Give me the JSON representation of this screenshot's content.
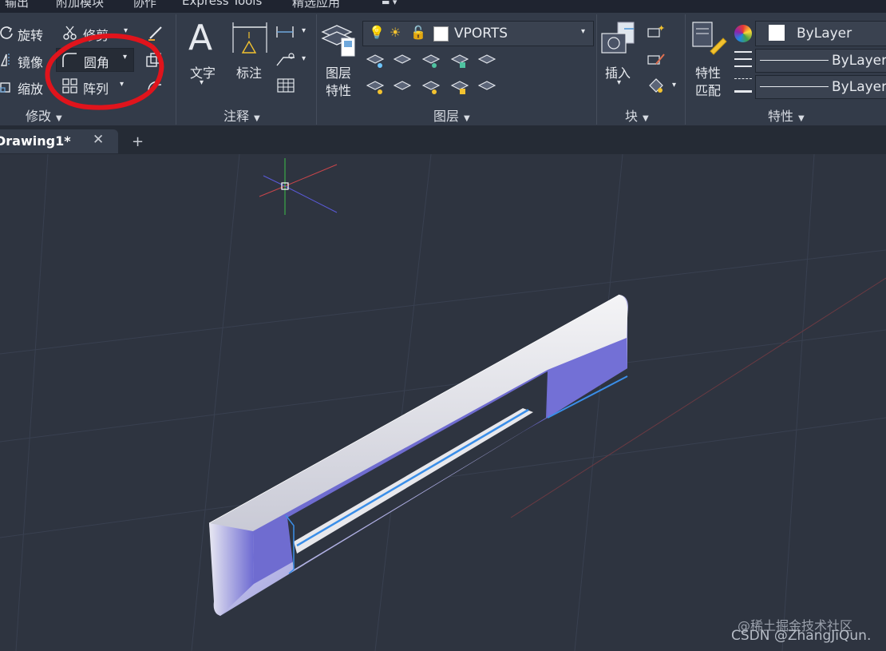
{
  "top_menu": [
    "输出",
    "附加模块",
    "协作",
    "Express Tools",
    "精选应用"
  ],
  "modify_panel": {
    "rotate": "旋转",
    "trim": "修剪",
    "mirror": "镜像",
    "fillet": "圆角",
    "scale": "缩放",
    "array": "阵列",
    "title": "修改"
  },
  "annotation_panel": {
    "text": "文字",
    "dimension": "标注",
    "title": "注释"
  },
  "layers_panel": {
    "layer_properties_line1": "图层",
    "layer_properties_line2": "特性",
    "current_layer": "VPORTS",
    "title": "图层"
  },
  "block_panel": {
    "insert": "插入",
    "title": "块"
  },
  "properties_panel": {
    "match_line1": "特性",
    "match_line2": "匹配",
    "color": "ByLayer",
    "linetype": "ByLayer",
    "lineweight": "ByLayer",
    "title": "特性"
  },
  "tabs": {
    "active": "Drawing1*",
    "add": "+"
  },
  "watermark": {
    "line1": "@稀土掘金技术社区",
    "line2": "CSDN @ZhangJiQun."
  }
}
